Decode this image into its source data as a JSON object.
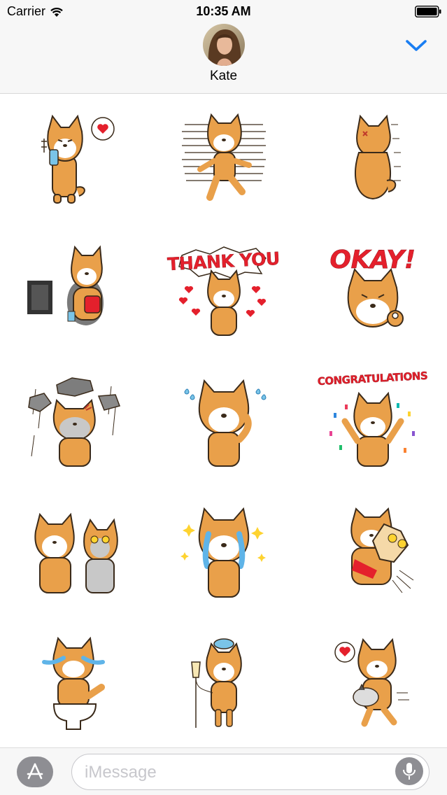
{
  "status_bar": {
    "carrier": "Carrier",
    "time": "10:35 AM",
    "wifi_icon": "wifi-icon",
    "battery_icon": "battery-icon"
  },
  "header": {
    "contact_name": "Kate",
    "avatar_icon": "avatar",
    "collapse_icon": "chevron-down-icon"
  },
  "stickers": [
    {
      "name": "shiba-eating-popsicle-heart",
      "caption": ""
    },
    {
      "name": "shiba-running-scared",
      "caption": ""
    },
    {
      "name": "shiba-back-turned-angry",
      "caption": ""
    },
    {
      "name": "shiba-watching-tv-popcorn",
      "caption": ""
    },
    {
      "name": "shiba-thank-you-hearts",
      "caption": "THANK YOU"
    },
    {
      "name": "shiba-okay-hand",
      "caption": "OKAY!"
    },
    {
      "name": "shiba-rocks-falling-gloom",
      "caption": ""
    },
    {
      "name": "shiba-sweating-waving",
      "caption": ""
    },
    {
      "name": "shiba-congratulations-confetti",
      "caption": "CONGRATULATIONS"
    },
    {
      "name": "shiba-with-corgi-friend",
      "caption": ""
    },
    {
      "name": "shiba-crying-tears",
      "caption": ""
    },
    {
      "name": "shiba-hugging-corgi",
      "caption": ""
    },
    {
      "name": "shiba-crying-on-toilet",
      "caption": ""
    },
    {
      "name": "shiba-sick-ice-pack-iv",
      "caption": ""
    },
    {
      "name": "shiba-holding-cat-heart",
      "caption": ""
    }
  ],
  "composer": {
    "placeholder": "iMessage",
    "apps_icon": "app-store-icon",
    "mic_icon": "microphone-icon"
  },
  "colors": {
    "bar_background": "#f7f7f7",
    "accent_blue": "#1a7ef2",
    "shiba_orange": "#e9a04a",
    "caption_red": "#e4202c",
    "gray_button": "#8e8e93"
  }
}
